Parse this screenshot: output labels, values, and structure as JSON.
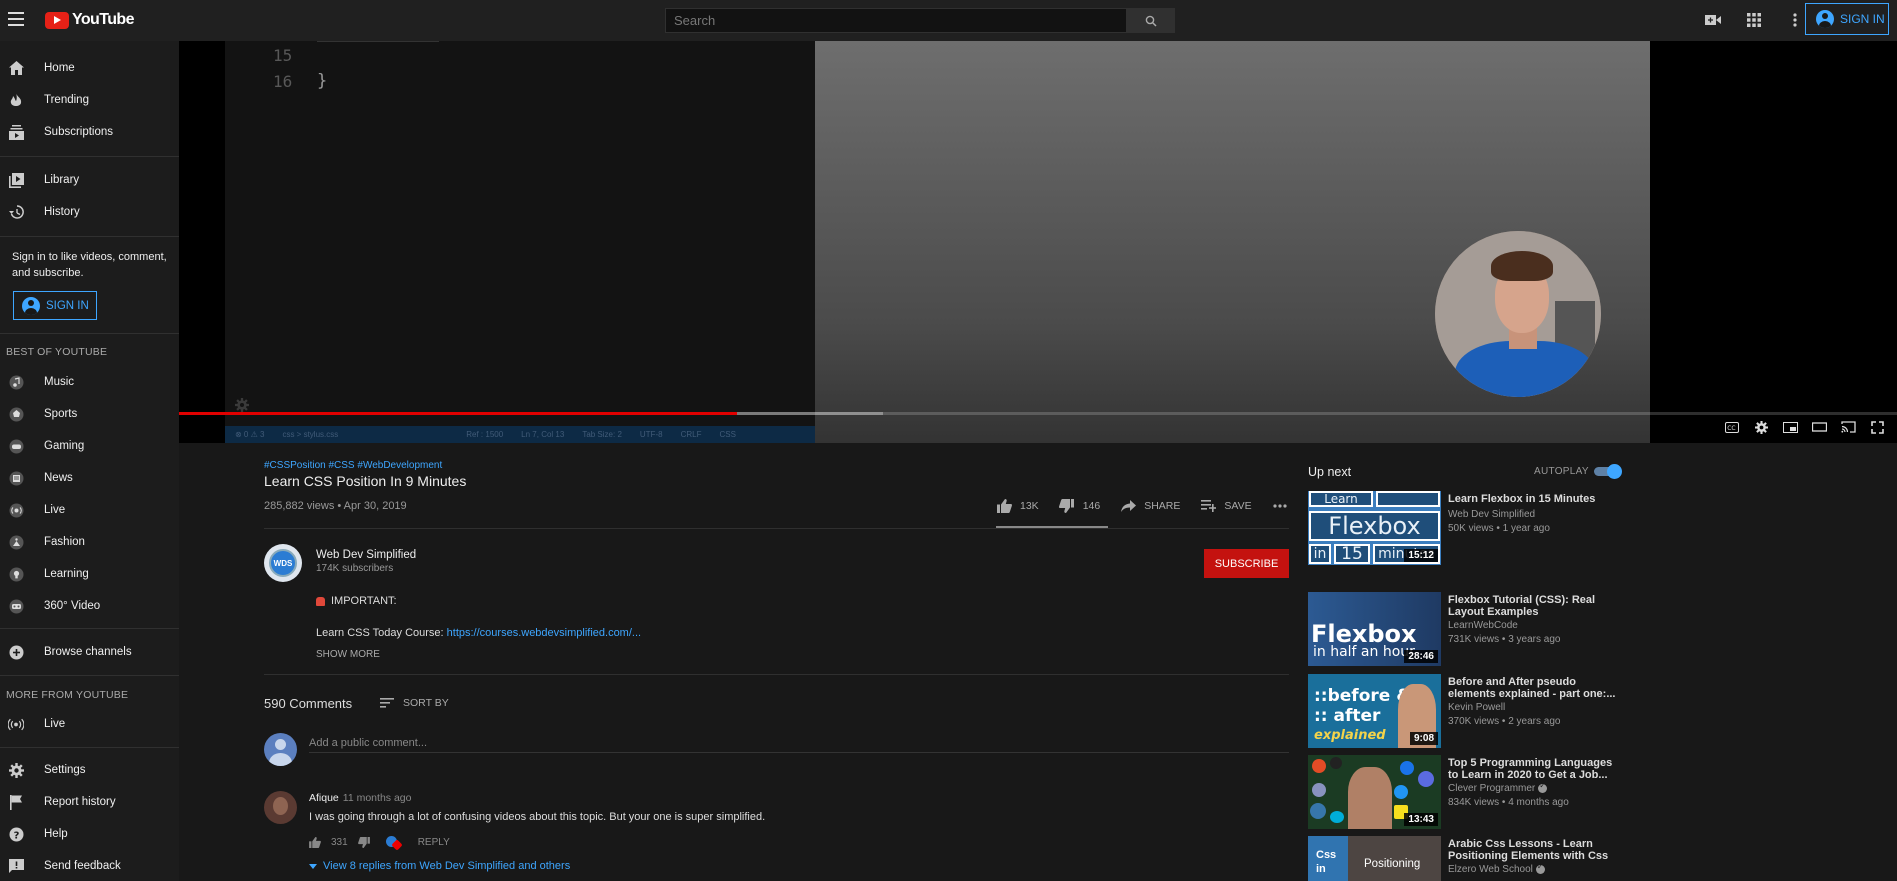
{
  "topbar": {
    "logo_text": "YouTube",
    "search_placeholder": "Search",
    "sign_in_label": "SIGN IN",
    "icons": [
      "video-camera-icon",
      "apps-grid-icon",
      "more-vert-icon"
    ]
  },
  "sidebar": {
    "main": [
      {
        "label": "Home",
        "icon": "home-icon"
      },
      {
        "label": "Trending",
        "icon": "flame-icon"
      },
      {
        "label": "Subscriptions",
        "icon": "subscriptions-icon"
      }
    ],
    "library": [
      {
        "label": "Library",
        "icon": "library-icon"
      },
      {
        "label": "History",
        "icon": "history-icon"
      }
    ],
    "sign_note": "Sign in to like videos, comment, and subscribe.",
    "sign_in_label": "SIGN IN",
    "best_title": "BEST OF YOUTUBE",
    "best": [
      {
        "label": "Music",
        "icon": "music-icon"
      },
      {
        "label": "Sports",
        "icon": "sports-icon"
      },
      {
        "label": "Gaming",
        "icon": "gaming-icon"
      },
      {
        "label": "News",
        "icon": "news-icon"
      },
      {
        "label": "Live",
        "icon": "live-icon"
      },
      {
        "label": "Fashion",
        "icon": "fashion-icon"
      },
      {
        "label": "Learning",
        "icon": "learning-icon"
      },
      {
        "label": "360° Video",
        "icon": "360-video-icon"
      }
    ],
    "browse_channels": "Browse channels",
    "more_title": "MORE FROM YOUTUBE",
    "more": [
      {
        "label": "Live",
        "icon": "broadcast-icon"
      }
    ],
    "footer": [
      {
        "label": "Settings",
        "icon": "gear-icon"
      },
      {
        "label": "Report history",
        "icon": "flag-icon"
      },
      {
        "label": "Help",
        "icon": "help-icon"
      },
      {
        "label": "Send feedback",
        "icon": "feedback-icon"
      }
    ]
  },
  "player": {
    "line_numbers": [
      "15",
      "16"
    ],
    "code_brace": "}",
    "status_bar": [
      "⊗ 0 ⚠ 3",
      "css > stylus.css",
      "Ref : 1500",
      "Ln 7, Col 13",
      "Tab Size: 2",
      "UTF-8",
      "CRLF",
      "CSS"
    ],
    "progress_played": 0.325,
    "progress_buffered": 0.41,
    "controls": [
      "captions-icon",
      "settings-icon",
      "miniplayer-icon",
      "theater-icon",
      "cast-icon",
      "fullscreen-icon"
    ]
  },
  "video": {
    "hashtags": "#CSSPosition #CSS #WebDevelopment",
    "title": "Learn CSS Position In 9 Minutes",
    "meta": "285,882 views • Apr 30, 2019",
    "likes": "13K",
    "dislikes": "146",
    "share": "SHARE",
    "save": "SAVE",
    "like_ratio": 0.989
  },
  "channel": {
    "name": "Web Dev Simplified",
    "subscribers": "174K subscribers",
    "avatar_text": "WDS",
    "subscribe_label": "SUBSCRIBE",
    "desc_line1": "IMPORTANT:",
    "desc_line2_prefix": "Learn CSS Today Course: ",
    "desc_link": "https://courses.webdevsimplified.com/...",
    "show_more": "SHOW MORE"
  },
  "comments": {
    "count": "590 Comments",
    "sort_label": "SORT BY",
    "add_placeholder": "Add a public comment...",
    "items": [
      {
        "author": "Afique",
        "time": "11 months ago",
        "text": "I was going through a lot of confusing videos about this topic. But your one is super simplified.",
        "likes": "331",
        "reply_label": "REPLY",
        "replies_label": "View 8 replies from Web Dev Simplified and others"
      }
    ]
  },
  "upnext": {
    "title": "Up next",
    "autoplay_label": "AUTOPLAY",
    "autoplay_on": true,
    "items": [
      {
        "title": "Learn Flexbox in 15 Minutes",
        "channel": "Web Dev Simplified",
        "meta": "50K views • 1 year ago",
        "duration": "15:12",
        "verified": false
      },
      {
        "title": "Flexbox Tutorial (CSS): Real Layout Examples",
        "channel": "LearnWebCode",
        "meta": "731K views • 3 years ago",
        "duration": "28:46",
        "verified": false
      },
      {
        "title": "Before and After pseudo elements explained - part one:...",
        "channel": "Kevin Powell",
        "meta": "370K views • 2 years ago",
        "duration": "9:08",
        "verified": false
      },
      {
        "title": "Top 5 Programming Languages to Learn in 2020 to Get a Job...",
        "channel": "Clever Programmer",
        "meta": "834K views • 4 months ago",
        "duration": "13:43",
        "verified": true
      },
      {
        "title": "Arabic Css Lessons - Learn Positioning Elements with Css",
        "channel": "Elzero Web School",
        "meta": "",
        "duration": "",
        "verified": true
      }
    ],
    "thumb_text": {
      "flexbox_words": [
        "Learn",
        "Flexbox",
        "in",
        "15",
        "minutes"
      ],
      "flexbox2_big": "Flexbox",
      "flexbox2_small": "in half an hour",
      "before_after": [
        "::before &",
        ":: after",
        "explained"
      ],
      "arabic_left": "Css in",
      "arabic_right": "Positioning"
    }
  }
}
